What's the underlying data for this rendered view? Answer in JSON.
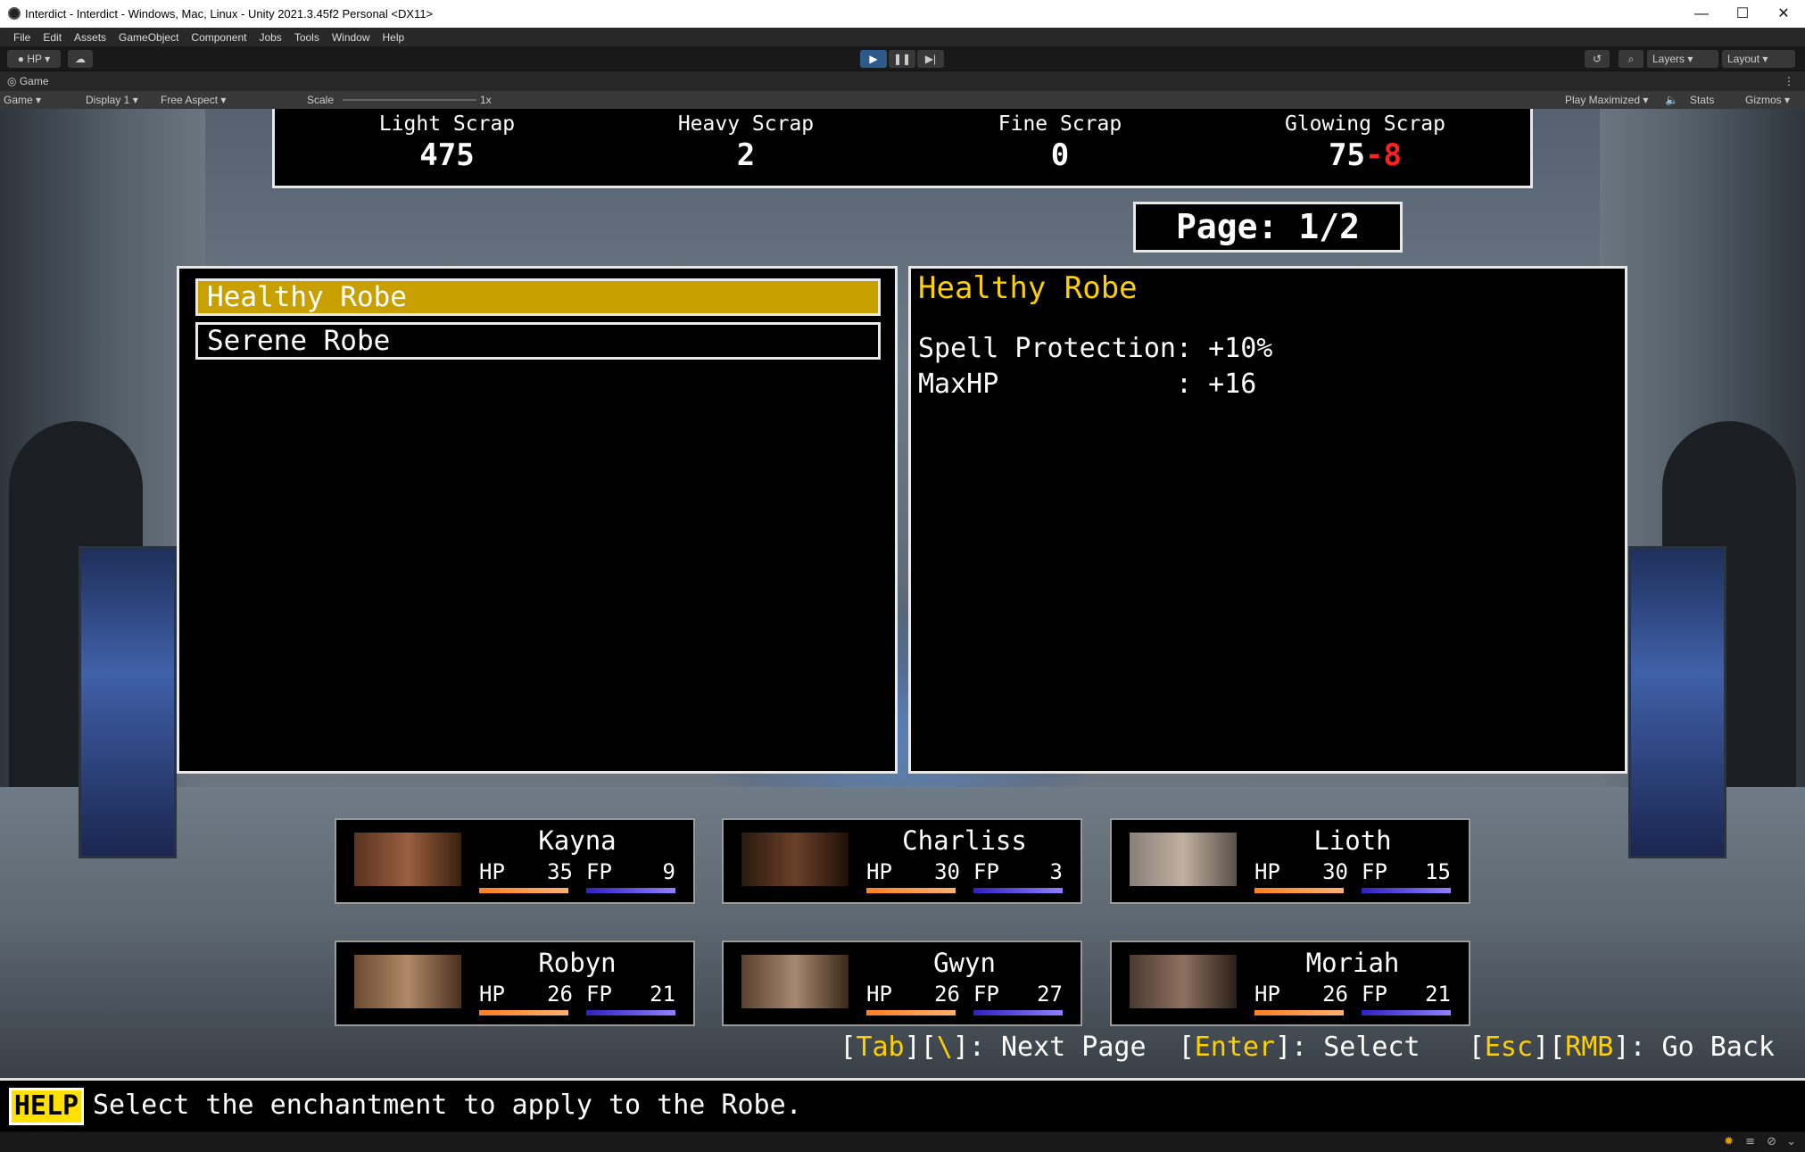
{
  "window": {
    "title": "Interdict - Interdict - Windows, Mac, Linux - Unity 2021.3.45f2 Personal <DX11>",
    "minimize": "—",
    "maximize": "☐",
    "close": "✕"
  },
  "menu": [
    "File",
    "Edit",
    "Assets",
    "GameObject",
    "Component",
    "Jobs",
    "Tools",
    "Window",
    "Help"
  ],
  "toolbar": {
    "account": "HP",
    "layers": "Layers",
    "layout": "Layout"
  },
  "game_tab": {
    "label": "Game",
    "view": "Game",
    "display": "Display 1",
    "aspect": "Free Aspect",
    "scale_label": "Scale",
    "scale_value": "1x",
    "play_mode": "Play Maximized",
    "stats": "Stats",
    "gizmos": "Gizmos"
  },
  "scrap": [
    {
      "label": "Light Scrap",
      "value": "475"
    },
    {
      "label": "Heavy Scrap",
      "value": "2"
    },
    {
      "label": "Fine Scrap",
      "value": "0"
    },
    {
      "label": "Glowing Scrap",
      "value": "75",
      "cost": "-8"
    }
  ],
  "page": "Page: 1/2",
  "items": [
    "Healthy Robe",
    "Serene Robe"
  ],
  "selected_index": 0,
  "detail": {
    "title": "Healthy Robe",
    "stats": [
      {
        "text": "Spell Protection: +10%"
      },
      {
        "text": "MaxHP           : +16"
      }
    ]
  },
  "party": [
    {
      "name": "Kayna",
      "hp": "35",
      "fp": "9"
    },
    {
      "name": "Charliss",
      "hp": "30",
      "fp": "3"
    },
    {
      "name": "Lioth",
      "hp": "30",
      "fp": "15"
    },
    {
      "name": "Robyn",
      "hp": "26",
      "fp": "21"
    },
    {
      "name": "Gwyn",
      "hp": "26",
      "fp": "27"
    },
    {
      "name": "Moriah",
      "hp": "26",
      "fp": "21"
    }
  ],
  "stat_labels": {
    "hp": "HP",
    "fp": "FP"
  },
  "hints": {
    "k1": "Tab",
    "k2": "\\",
    "a1": ": Next Page",
    "k3": "Enter",
    "a2": ": Select",
    "k4": "Esc",
    "k5": "RMB",
    "a3": ": Go Back"
  },
  "help": {
    "badge": "HELP",
    "text": "Select the enchantment to apply to the Robe."
  }
}
